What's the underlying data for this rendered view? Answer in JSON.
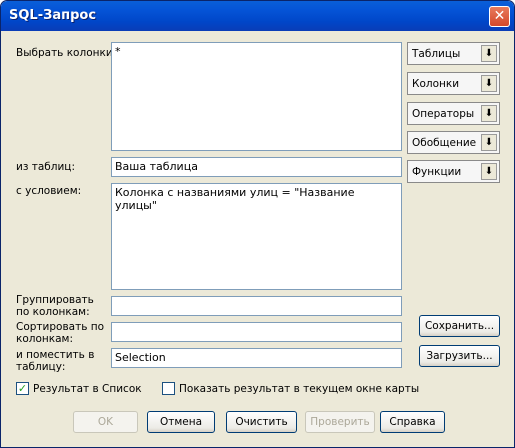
{
  "window": {
    "title": "SQL-Запрос",
    "close_glyph": "✕"
  },
  "labels": {
    "select_columns": "Выбрать колонки:",
    "from_tables": "из таблиц:",
    "condition": "с условием:",
    "group_by": "Группировать по колонкам:",
    "order_by": "Сортировать по колонкам:",
    "into_table": "и поместить в таблицу:"
  },
  "fields": {
    "columns_value": "*",
    "tables_value": "Ваша таблица",
    "condition_value": "Колонка с названиями улиц = \"Название улицы\"",
    "group_by_value": "",
    "order_by_value": "",
    "into_table_value": "Selection"
  },
  "dropdowns": [
    {
      "label": "Таблицы"
    },
    {
      "label": "Колонки"
    },
    {
      "label": "Операторы"
    },
    {
      "label": "Обобщение"
    },
    {
      "label": "Функции"
    }
  ],
  "side_buttons": {
    "save": "Сохранить...",
    "load": "Загрузить..."
  },
  "checkboxes": {
    "result_to_list": {
      "label": "Результат в Список",
      "checked": true
    },
    "show_in_map": {
      "label": "Показать результат в текущем окне карты",
      "checked": false
    }
  },
  "buttons": {
    "ok": "OK",
    "cancel": "Отмена",
    "clear": "Очистить",
    "verify": "Проверить",
    "help": "Справка"
  },
  "icons": {
    "dropdown_arrow": "⬇",
    "check_mark": "✓"
  }
}
